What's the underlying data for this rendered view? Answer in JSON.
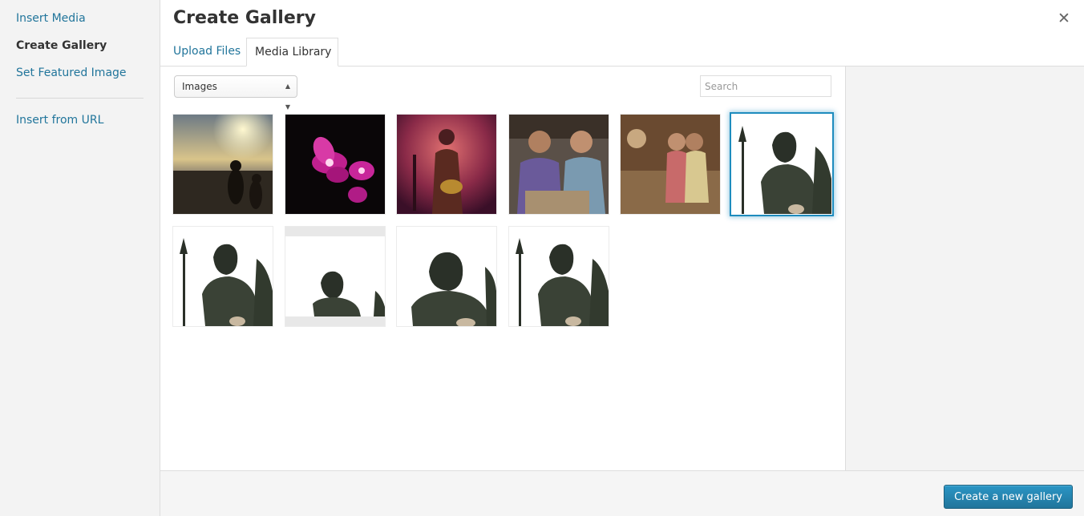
{
  "sidebar": {
    "items": [
      {
        "label": "Insert Media"
      },
      {
        "label": "Create Gallery"
      },
      {
        "label": "Set Featured Image"
      },
      {
        "label": "Insert from URL"
      }
    ]
  },
  "header": {
    "title": "Create Gallery",
    "close_icon": "close-icon"
  },
  "tabs": [
    {
      "label": "Upload Files"
    },
    {
      "label": "Media Library"
    }
  ],
  "toolbar": {
    "filter_value": "Images",
    "search_placeholder": "Search"
  },
  "footer": {
    "button_label": "Create a new gallery"
  },
  "colors": {
    "link": "#21759b",
    "primary_button": "#2a95c5",
    "selection": "#1e8cbe"
  }
}
